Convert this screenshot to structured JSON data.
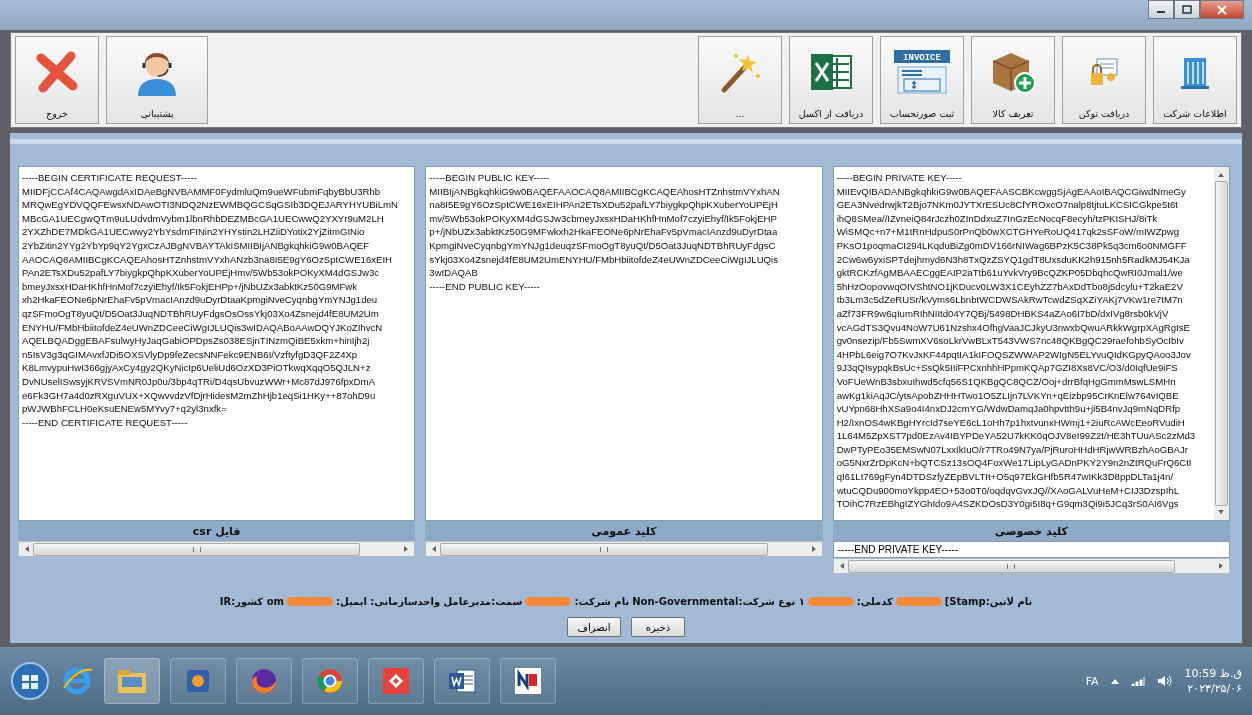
{
  "toolbar": {
    "left_buttons": [
      {
        "label": "پشتیبانی",
        "kind": "support"
      },
      {
        "label": "خروج",
        "kind": "exit"
      }
    ],
    "right_buttons": [
      {
        "label": "اطلاعات شرکت",
        "kind": "building"
      },
      {
        "label": "دریافت توکن",
        "kind": "token"
      },
      {
        "label": "تعریف کالا",
        "kind": "box"
      },
      {
        "label": "ثبت صورتحساب",
        "kind": "invoice",
        "icon_text": "INVOICE"
      },
      {
        "label": "دریافت از اکسل",
        "kind": "excel"
      },
      {
        "label": "...",
        "kind": "wand"
      }
    ]
  },
  "panels": [
    {
      "lines": [
        "-----BEGIN CERTIFICATE REQUEST-----",
        "MIIDFjCCAf4CAQAwgdAxIDAeBgNVBAMMF0FydmluQm9ueWFubmFqbyBbU3Rhb",
        "MRQwEgYDVQQFEwsxNDAwOTI3NDQ2NzEWMBQGCSqGSIb3DQEJARYHYUBiLmN",
        "MBcGA1UECgwQTm9uLUdvdmVybm1lbnRhbDEZMBcGA1UECwwQ2YXYr9uM2LH",
        "2YXZhDE7MDkGA1UECwwy2YbYsdmFINin2YHYstin2LHZiiDYotix2YjZitmGINio",
        "2YbZitin2YYg2YbYp9qY2YgxCzAJBgNVBAYTAkISMIIBIjANBgkqhkiG9w0BAQEF",
        "AAOCAQ8AMIIBCgKCAQEAhosHTZnhstmVYxhANzb3na8I5E9gY6OzSptCWE16xEIH",
        "PAn2ETsXDu52pafLY7biygkpQhpKXuberYoUPEjHmv/5Wb53okPOKyXM4dGSJw3c",
        "bmeyJxsxHDaHKhfHnMof7czyiEhyf/Ik5FokjEHPp+/jNbUZx3abktKz50G9MFwk",
        "xh2HkaFEONe6pNrEhaFv5pVmacIAnzd9uDyrDtaaKpmgiNveCyqnbgYmYNJg1deu",
        "qzSFmoOgT8yuQt/D5Oat3JuqNDTBhRUyFdgsOsOssYkj03Xo4Zsnejd4fE8UM2Um",
        "ENYHU/FMbHbiitofdeZ4eUWnZDCeeCiWgIJLUQis3wIDAQABoAAwDQYJKoZIhvcN",
        "AQELBQADggEBAFsulwyHyJaqGabiOPDpsZs038ESjnTINzmQiBE5xkm+hinIjh2j",
        "n5IsV3g3qGIMAvxfJDi5OXSVlyDp9feZecsNNFekc9ENB6I/VzftyfgD3QF2Z4Xp",
        "K8LmvypuHwI366gjyAxCy4gy2QKyNicIp6UeliUd6OzXD3PiOTkwqXqqO5QJLN+z",
        "DvNUselISwsyjKRVSVmNR0Jp0u/3bp4qTRi/D4qsUbvuzWWr+Mc87dJ976fpxDmA",
        "e6Fk3GH7a4d0zRXguVUX+XQwvvdzVfDjrHidesM2mZhHjb1eqSi1HKy++87ohD9u",
        "pWJWBhFCLH0eKsuENEw5MYvy7+q2yl3nxfk=",
        "-----END CERTIFICATE REQUEST-----"
      ]
    },
    {
      "lines": [
        "-----BEGIN PUBLIC KEY-----",
        "MIIBIjANBgkqhkiG9w0BAQEFAAOCAQ8AMIIBCgKCAQEAhosHTZnhstmVYxhAN",
        "na8I5E9gY6OzSptCWE16xEIHPAn2ETsXDu52pafLY7biygkpQhpKXuberYoUPEjH",
        "mv/5Wb53okPOKyXM4dGSJw3cbmeyJxsxHDaHKhfHnMof7czyiEhyf/Ik5FokjEHP",
        "p+/jNbUZx3abktKz50G9MFwkxh2HkaFEONe6pNrEhaFv5pVmacIAnzd9uDyrDtaa",
        "KpmgiNveCyqnbgYmYNJg1deuqzSFmoOgT8yuQt/D5Oat3JuqNDTBhRUyFdgsC",
        "sYkj03Xo4Zsnejd4fE8UM2UmENYHU/FMbHbiitofdeZ4eUWnZDCeeCiWgIJLUQis",
        "3wIDAQAB",
        "-----END PUBLIC KEY-----"
      ]
    },
    {
      "field": "-----END PRIVATE KEY-----",
      "lines": [
        "-----BEGIN PRIVATE KEY-----",
        "MIIEvQIBADANBgkqhkiG9w0BAQEFAASCBKcwggSjAgEAAoIBAQCGiwdNmeGy",
        "GEA3NvedrwjkT2Bjo7NKm0JYTXrESUc8CfYROxcO7nalp8tjtuLKCSICGkpe5t6t",
        "ihQ8SMea//IZvneiQ84rJczh0ZInDdxuZ7InGzEcNocqF8ecyh/tzPKISHJ/8iTk",
        "WiSMQc+n7+M1tRnHdpuS0rPnQb0wXCTGHYeRoUQ417qk2sSFoW/mIWZpwg",
        "PKsO1poqmaCI294LKqduBiZg0mDV166rNIWag6BPzK5C38Pk5q3cm6o0NMGFF",
        "2Cw6w6yxiSPTdejhmyd6N3h8TxQzZSYQ1gdT8UxsduKK2h915nh5RadkMJ54KJa",
        "gktRCKzfAgMBAAECggEAIP2aTtb61uYvkVry9BcQZKP05DbqhcQwRI0Jmal1/we",
        "5hHzOopovwqOIVShtNO1jKDucv0LW3X1CEyhZZ7bAxDdTbo8j5dcylu+T2kaE2V",
        "tb3Lm3c5dZeRUSr/kVyms6LbnbtWCDWSAkRwTcwdZSqXZiYAKj7VKw1re7tM7n",
        "aZf73FR9w6qIumRIhNIItd04Y7QBj/5498DHBKS4aZAo6I7bD/dxIVg8rsb0kVjV",
        "vcAGdTS3Qvu4NoW7U61Nzshx4OfhgVaaJCJkyU3nwxbQwuARkkWgrpXAgRgIsE",
        "gv0nsezip/Fb5SwmXV6soLkrVwBLxT543VWS7nc48QKBgQC29raefohbSyOcIbIv",
        "4HPbL6eig7O7KvJxKF44pqtIA1kIFOQSZWWAP2WIgN5ELYvuQIdKGpyQAoo3Jov",
        "9J3qQIsypqkBsUc+SsQk5IIiFPCxnhhHPpmKQAp7GZI8Xs8VC/O3/d0IqfUe9iFS",
        "VoFUeWnB3sbxuIhwd5cfq56S1QKBgQC8QCZ/Ooj+drrBfqHgGmmMswLSMHn",
        "awKg1kiAqJC/ytsApobZHHHTwo1O5ZLIjn7LVKYn+qEizbp95CrKnElw764vIQBE",
        "vUYpn68HhXSa9o4I4nxDJ2cmYG/WdwDamqJa0hpvtth9u+ji5B4nvJq9mNqDRfp",
        "H2/IxnOS4wKBgHYrcId7seYE6cL1oHh7p1hxtvunxHWmj1+2iuRcAWcEeoRVudiH",
        "1L64M5ZpXST7pd0EzAv4IBYPDeYA52U7kKK0qOJV8eI99Z2t/HE3hTUuASc2zMd3",
        "DwPTyPEo35EMSwN07LxxIkIuO/r7TRo49N7ya/PjRuroHHdHRjwWRBzhAoGBAJr",
        "oG5NxrZrDpKcN+bQTCSz13sOQ4FoxWe17LipLyGADnPKY2Y9n2nZtRQuFrQ6CtI",
        "qI61Lt769gFyn4DTDSzfyZEpBVLTIt+O5q97EkGHfb5R47wIKk3D8ppDLTa1j4n/",
        "wtuCQDu900moYkpp4EO+53o0T0/oqdqvGvxJQ//XAoGALVuHeM+CIJ3DzspIhL",
        "TOihC7RzEBhgIZYGhIdo9A4SZKDOsD3Y0gi5I8q+G9qm3Qi9i5JCq3rS0AI6Vgs"
      ]
    }
  ],
  "panel_labels": [
    "کلید خصوصی",
    "کلید عمومی",
    "csr فایل"
  ],
  "info_line": [
    {
      "kind": "text",
      "text": "نام لاتین:Stamp]"
    },
    {
      "kind": "redaction"
    },
    {
      "kind": "text",
      "text": "کدملی:"
    },
    {
      "kind": "redaction"
    },
    {
      "kind": "text",
      "text": "۱ نوع شرکت:Non-Governmental"
    },
    {
      "kind": "text",
      "text": "نام شرکت:"
    },
    {
      "kind": "redaction"
    },
    {
      "kind": "text",
      "text": "سمت:مدیرعامل واحدسازمانی: ایمیل:"
    },
    {
      "kind": "redaction"
    },
    {
      "kind": "text",
      "text": "om کشور:IR"
    }
  ],
  "actions": [
    "ذخیره",
    "انصراف"
  ],
  "tray": {
    "language": "FA",
    "time": "10:59 ق.ظ",
    "date": "۲۰۲۳/۲۵/۰۶"
  }
}
